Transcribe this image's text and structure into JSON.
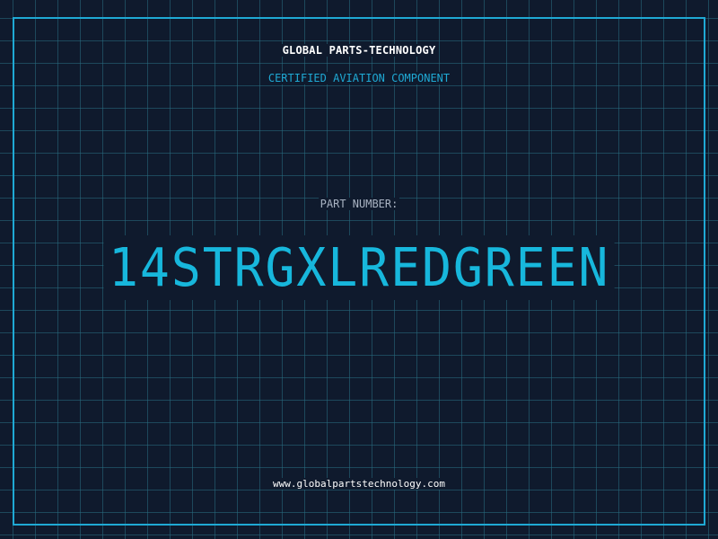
{
  "brand": "GLOBAL PARTS-TECHNOLOGY",
  "subtitle": "CERTIFIED AVIATION COMPONENT",
  "part": {
    "label": "PART NUMBER:",
    "value": "14STRGXLREDGREEN"
  },
  "footer": {
    "url": "www.globalpartstechnology.com"
  },
  "colors": {
    "background": "#0f1a2d",
    "grid": "#286e82",
    "accent": "#1fa9d4",
    "part_number": "#17b7dc",
    "text": "#ffffff",
    "muted": "#a9b3c2"
  }
}
